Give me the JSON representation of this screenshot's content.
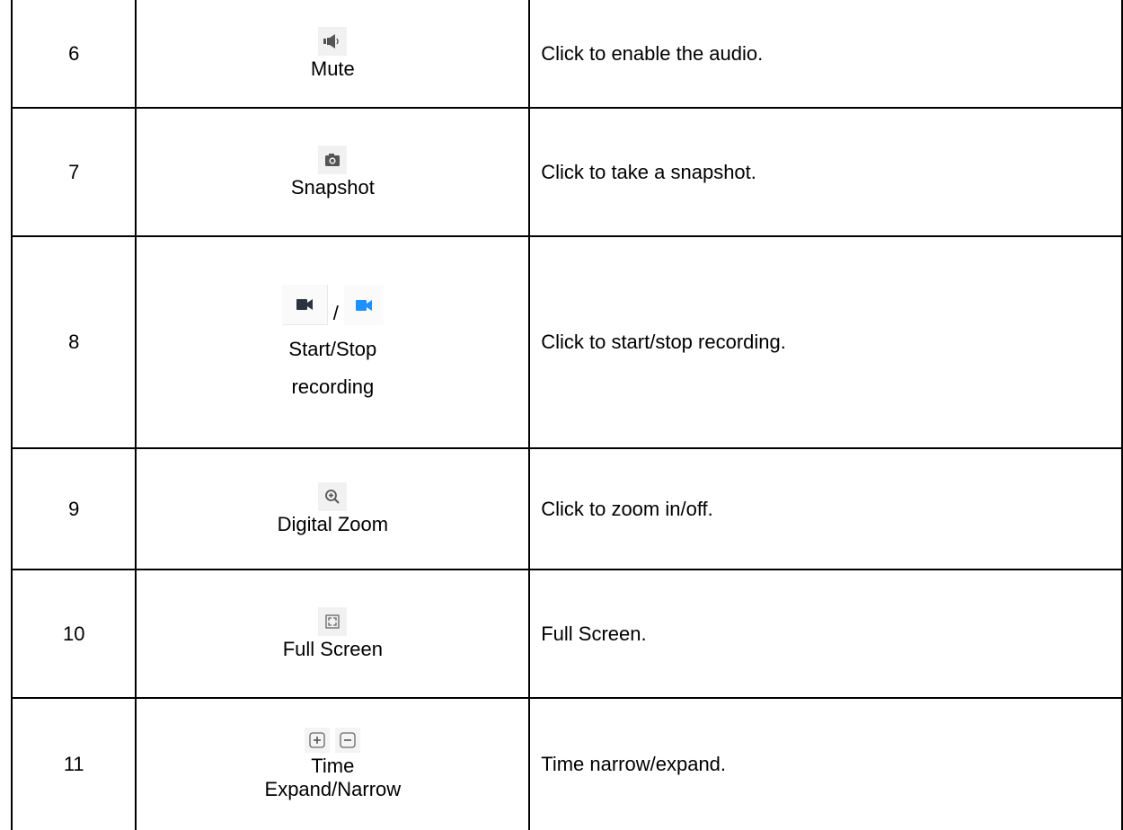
{
  "rows": [
    {
      "num": "6",
      "label": "Mute",
      "desc": "Click to enable the audio.",
      "icon": "speaker-icon"
    },
    {
      "num": "7",
      "label": "Snapshot",
      "desc": "Click to take a snapshot.",
      "icon": "camera-icon"
    },
    {
      "num": "8",
      "label_line1": "Start/Stop",
      "label_line2": "recording",
      "separator": "/",
      "desc": "Click to start/stop recording.",
      "icons": [
        "record-icon",
        "record-active-icon"
      ],
      "active_color": "#1e90ff"
    },
    {
      "num": "9",
      "label": "Digital Zoom",
      "desc": "Click to zoom in/off.",
      "icon": "zoom-in-icon"
    },
    {
      "num": "10",
      "label": "Full Screen",
      "desc": "Full Screen.",
      "icon": "fullscreen-icon"
    },
    {
      "num": "11",
      "label_line1": "Time",
      "label_line2": "Expand/Narrow",
      "desc": "Time narrow/expand.",
      "icons": [
        "plus-icon",
        "minus-icon"
      ]
    }
  ]
}
